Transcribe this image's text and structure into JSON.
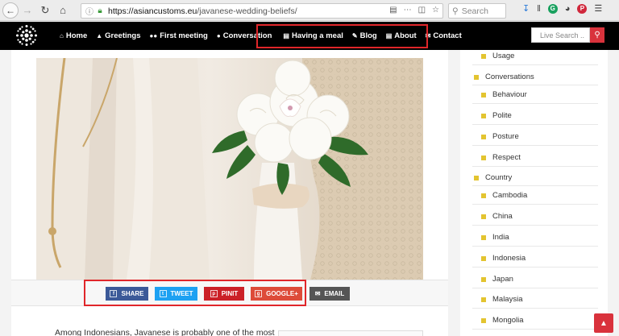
{
  "browser": {
    "back_icon": "back-arrow-icon",
    "url_host": "https://asiancustoms.eu",
    "url_path": "/javanese-wedding-beliefs/",
    "search_placeholder": "Search",
    "ext_g_label": "G",
    "ext_p_label": "P"
  },
  "nav": {
    "items": [
      {
        "label": "Home",
        "icon": "home-icon"
      },
      {
        "label": "Greetings",
        "icon": "thumbs-up-icon"
      },
      {
        "label": "First meeting",
        "icon": "users-icon"
      },
      {
        "label": "Conversation",
        "icon": "comment-icon"
      },
      {
        "label": "Having a meal",
        "icon": "image-icon"
      },
      {
        "label": "Blog",
        "icon": "pencil-icon"
      },
      {
        "label": "About",
        "icon": "image-icon"
      },
      {
        "label": "Contact",
        "icon": "envelope-icon"
      }
    ],
    "live_search_placeholder": "Live Search ..",
    "accent": "#d9323c"
  },
  "share": {
    "buttons": [
      {
        "label": "SHARE",
        "color": "#3b5998"
      },
      {
        "label": "TWEET",
        "color": "#1da1f2"
      },
      {
        "label": "PINIT",
        "color": "#cb2027"
      },
      {
        "label": "GOOGLE+",
        "color": "#dd4b39"
      },
      {
        "label": "EMAIL",
        "color": "#555555"
      }
    ]
  },
  "article": {
    "intro": "Among Indonesians, Javanese is probably one of the most"
  },
  "sidebar": {
    "items": [
      {
        "label": "Usage",
        "level": 2
      },
      {
        "label": "Conversations",
        "level": 1
      },
      {
        "label": "Behaviour",
        "level": 2
      },
      {
        "label": "Polite",
        "level": 2
      },
      {
        "label": "Posture",
        "level": 2
      },
      {
        "label": "Respect",
        "level": 2
      },
      {
        "label": "Country",
        "level": 1
      },
      {
        "label": "Cambodia",
        "level": 2
      },
      {
        "label": "China",
        "level": 2
      },
      {
        "label": "India",
        "level": 2
      },
      {
        "label": "Indonesia",
        "level": 2
      },
      {
        "label": "Japan",
        "level": 2
      },
      {
        "label": "Malaysia",
        "level": 2
      },
      {
        "label": "Mongolia",
        "level": 2
      }
    ]
  }
}
